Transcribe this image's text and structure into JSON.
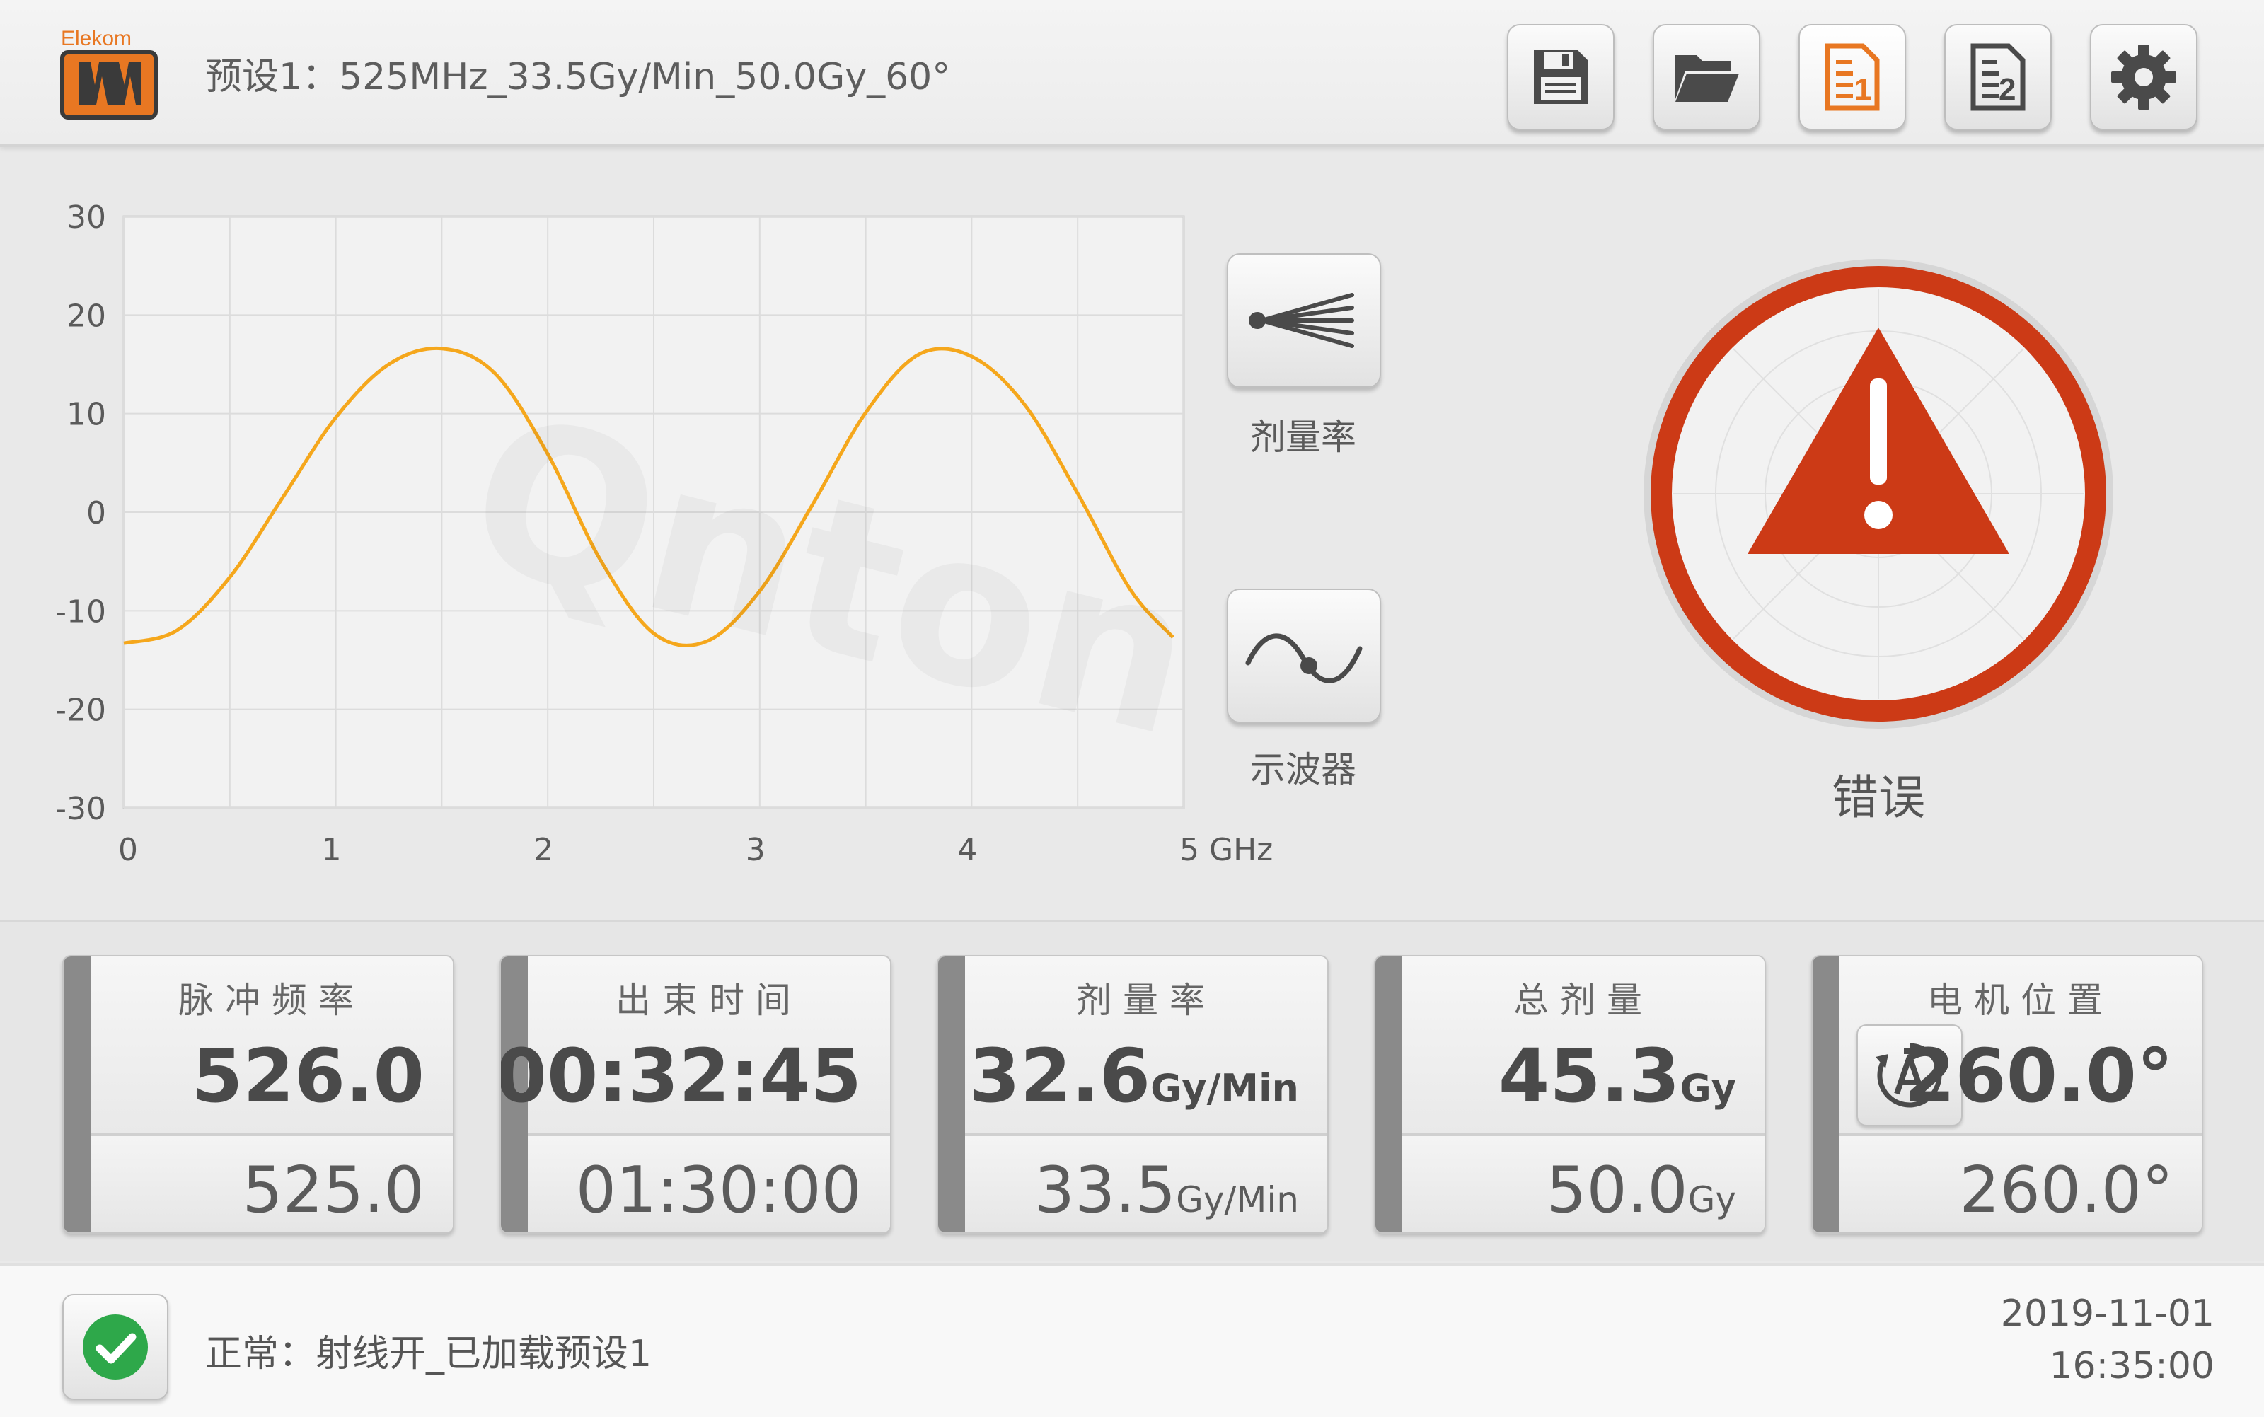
{
  "header": {
    "logo_text": "Elekom",
    "preset_title": "预设1：525MHz_33.5Gy/Min_50.0Gy_60°",
    "toolbar": [
      {
        "name": "save-button",
        "icon": "floppy-disk-icon"
      },
      {
        "name": "open-folder-button",
        "icon": "folder-open-icon"
      },
      {
        "name": "preset-1-button",
        "icon": "document-1-icon",
        "active": true
      },
      {
        "name": "preset-2-button",
        "icon": "document-2-icon"
      },
      {
        "name": "settings-button",
        "icon": "gear-icon"
      }
    ]
  },
  "chart_data": {
    "type": "line",
    "title": "",
    "xlabel": "",
    "ylabel": "",
    "x_unit": "GHz",
    "xlim": [
      0,
      5
    ],
    "ylim": [
      -30,
      30
    ],
    "x_ticks": [
      "0",
      "1",
      "2",
      "3",
      "4",
      "5 GHz"
    ],
    "y_ticks": [
      "30",
      "20",
      "10",
      "0",
      "-10",
      "-20",
      "-30"
    ],
    "grid": true,
    "series": [
      {
        "color": "#f5a71c",
        "x": [
          0,
          0.25,
          0.5,
          0.75,
          1.0,
          1.25,
          1.5,
          1.75,
          2.0,
          2.25,
          2.5,
          2.75,
          3.0,
          3.25,
          3.5,
          3.75,
          4.0,
          4.25,
          4.5,
          4.75,
          4.95
        ],
        "y": [
          -13.3,
          -12.0,
          -6.6,
          1.5,
          9.6,
          15.0,
          16.6,
          14.1,
          5.9,
          -4.9,
          -12.3,
          -13.1,
          -8.0,
          0.8,
          10.1,
          16.0,
          15.8,
          10.9,
          1.9,
          -7.9,
          -12.7
        ]
      }
    ]
  },
  "side_buttons": {
    "dose_rate_label": "剂量率",
    "oscilloscope_label": "示波器"
  },
  "alarm": {
    "label": "错误",
    "color": "#cc3a16"
  },
  "cards": {
    "pulse_freq": {
      "label": "脉冲频率",
      "value": "526.0",
      "setpoint": "525.0"
    },
    "beam_time": {
      "label": "出束时间",
      "value": "00:32:45",
      "setpoint": "01:30:00"
    },
    "dose_rate": {
      "label": "剂量率",
      "value": "32.6",
      "unit": "Gy/Min",
      "setpoint": "33.5",
      "set_unit": "Gy/Min"
    },
    "total_dose": {
      "label": "总剂量",
      "value": "45.3",
      "unit": "Gy",
      "setpoint": "50.0",
      "set_unit": "Gy"
    },
    "motor_pos": {
      "label": "电机位置",
      "value": "260.0°",
      "setpoint": "260.0°",
      "auto_icon": "auto-rotate-icon"
    }
  },
  "footer": {
    "status": "正常：射线开_已加载预设1",
    "date": "2019-11-01",
    "time": "16:35:00",
    "ok_color": "#2ea84a"
  }
}
